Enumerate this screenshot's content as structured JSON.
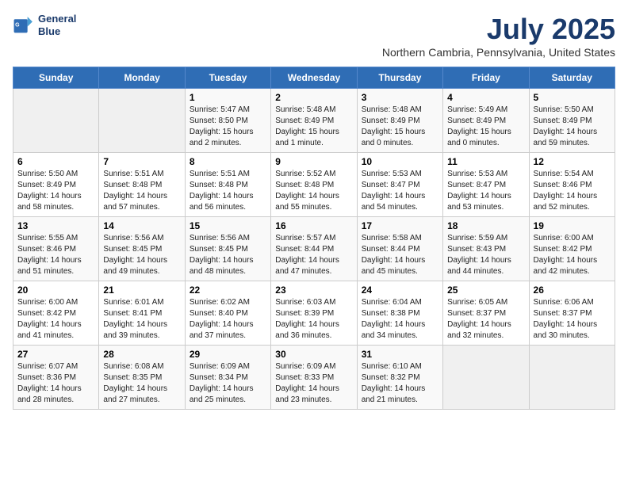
{
  "logo": {
    "line1": "General",
    "line2": "Blue"
  },
  "title": {
    "month_year": "July 2025",
    "location": "Northern Cambria, Pennsylvania, United States"
  },
  "days_of_week": [
    "Sunday",
    "Monday",
    "Tuesday",
    "Wednesday",
    "Thursday",
    "Friday",
    "Saturday"
  ],
  "weeks": [
    [
      {
        "day": "",
        "sunrise": "",
        "sunset": "",
        "daylight": ""
      },
      {
        "day": "",
        "sunrise": "",
        "sunset": "",
        "daylight": ""
      },
      {
        "day": "1",
        "sunrise": "Sunrise: 5:47 AM",
        "sunset": "Sunset: 8:50 PM",
        "daylight": "Daylight: 15 hours and 2 minutes."
      },
      {
        "day": "2",
        "sunrise": "Sunrise: 5:48 AM",
        "sunset": "Sunset: 8:49 PM",
        "daylight": "Daylight: 15 hours and 1 minute."
      },
      {
        "day": "3",
        "sunrise": "Sunrise: 5:48 AM",
        "sunset": "Sunset: 8:49 PM",
        "daylight": "Daylight: 15 hours and 0 minutes."
      },
      {
        "day": "4",
        "sunrise": "Sunrise: 5:49 AM",
        "sunset": "Sunset: 8:49 PM",
        "daylight": "Daylight: 15 hours and 0 minutes."
      },
      {
        "day": "5",
        "sunrise": "Sunrise: 5:50 AM",
        "sunset": "Sunset: 8:49 PM",
        "daylight": "Daylight: 14 hours and 59 minutes."
      }
    ],
    [
      {
        "day": "6",
        "sunrise": "Sunrise: 5:50 AM",
        "sunset": "Sunset: 8:49 PM",
        "daylight": "Daylight: 14 hours and 58 minutes."
      },
      {
        "day": "7",
        "sunrise": "Sunrise: 5:51 AM",
        "sunset": "Sunset: 8:48 PM",
        "daylight": "Daylight: 14 hours and 57 minutes."
      },
      {
        "day": "8",
        "sunrise": "Sunrise: 5:51 AM",
        "sunset": "Sunset: 8:48 PM",
        "daylight": "Daylight: 14 hours and 56 minutes."
      },
      {
        "day": "9",
        "sunrise": "Sunrise: 5:52 AM",
        "sunset": "Sunset: 8:48 PM",
        "daylight": "Daylight: 14 hours and 55 minutes."
      },
      {
        "day": "10",
        "sunrise": "Sunrise: 5:53 AM",
        "sunset": "Sunset: 8:47 PM",
        "daylight": "Daylight: 14 hours and 54 minutes."
      },
      {
        "day": "11",
        "sunrise": "Sunrise: 5:53 AM",
        "sunset": "Sunset: 8:47 PM",
        "daylight": "Daylight: 14 hours and 53 minutes."
      },
      {
        "day": "12",
        "sunrise": "Sunrise: 5:54 AM",
        "sunset": "Sunset: 8:46 PM",
        "daylight": "Daylight: 14 hours and 52 minutes."
      }
    ],
    [
      {
        "day": "13",
        "sunrise": "Sunrise: 5:55 AM",
        "sunset": "Sunset: 8:46 PM",
        "daylight": "Daylight: 14 hours and 51 minutes."
      },
      {
        "day": "14",
        "sunrise": "Sunrise: 5:56 AM",
        "sunset": "Sunset: 8:45 PM",
        "daylight": "Daylight: 14 hours and 49 minutes."
      },
      {
        "day": "15",
        "sunrise": "Sunrise: 5:56 AM",
        "sunset": "Sunset: 8:45 PM",
        "daylight": "Daylight: 14 hours and 48 minutes."
      },
      {
        "day": "16",
        "sunrise": "Sunrise: 5:57 AM",
        "sunset": "Sunset: 8:44 PM",
        "daylight": "Daylight: 14 hours and 47 minutes."
      },
      {
        "day": "17",
        "sunrise": "Sunrise: 5:58 AM",
        "sunset": "Sunset: 8:44 PM",
        "daylight": "Daylight: 14 hours and 45 minutes."
      },
      {
        "day": "18",
        "sunrise": "Sunrise: 5:59 AM",
        "sunset": "Sunset: 8:43 PM",
        "daylight": "Daylight: 14 hours and 44 minutes."
      },
      {
        "day": "19",
        "sunrise": "Sunrise: 6:00 AM",
        "sunset": "Sunset: 8:42 PM",
        "daylight": "Daylight: 14 hours and 42 minutes."
      }
    ],
    [
      {
        "day": "20",
        "sunrise": "Sunrise: 6:00 AM",
        "sunset": "Sunset: 8:42 PM",
        "daylight": "Daylight: 14 hours and 41 minutes."
      },
      {
        "day": "21",
        "sunrise": "Sunrise: 6:01 AM",
        "sunset": "Sunset: 8:41 PM",
        "daylight": "Daylight: 14 hours and 39 minutes."
      },
      {
        "day": "22",
        "sunrise": "Sunrise: 6:02 AM",
        "sunset": "Sunset: 8:40 PM",
        "daylight": "Daylight: 14 hours and 37 minutes."
      },
      {
        "day": "23",
        "sunrise": "Sunrise: 6:03 AM",
        "sunset": "Sunset: 8:39 PM",
        "daylight": "Daylight: 14 hours and 36 minutes."
      },
      {
        "day": "24",
        "sunrise": "Sunrise: 6:04 AM",
        "sunset": "Sunset: 8:38 PM",
        "daylight": "Daylight: 14 hours and 34 minutes."
      },
      {
        "day": "25",
        "sunrise": "Sunrise: 6:05 AM",
        "sunset": "Sunset: 8:37 PM",
        "daylight": "Daylight: 14 hours and 32 minutes."
      },
      {
        "day": "26",
        "sunrise": "Sunrise: 6:06 AM",
        "sunset": "Sunset: 8:37 PM",
        "daylight": "Daylight: 14 hours and 30 minutes."
      }
    ],
    [
      {
        "day": "27",
        "sunrise": "Sunrise: 6:07 AM",
        "sunset": "Sunset: 8:36 PM",
        "daylight": "Daylight: 14 hours and 28 minutes."
      },
      {
        "day": "28",
        "sunrise": "Sunrise: 6:08 AM",
        "sunset": "Sunset: 8:35 PM",
        "daylight": "Daylight: 14 hours and 27 minutes."
      },
      {
        "day": "29",
        "sunrise": "Sunrise: 6:09 AM",
        "sunset": "Sunset: 8:34 PM",
        "daylight": "Daylight: 14 hours and 25 minutes."
      },
      {
        "day": "30",
        "sunrise": "Sunrise: 6:09 AM",
        "sunset": "Sunset: 8:33 PM",
        "daylight": "Daylight: 14 hours and 23 minutes."
      },
      {
        "day": "31",
        "sunrise": "Sunrise: 6:10 AM",
        "sunset": "Sunset: 8:32 PM",
        "daylight": "Daylight: 14 hours and 21 minutes."
      },
      {
        "day": "",
        "sunrise": "",
        "sunset": "",
        "daylight": ""
      },
      {
        "day": "",
        "sunrise": "",
        "sunset": "",
        "daylight": ""
      }
    ]
  ]
}
